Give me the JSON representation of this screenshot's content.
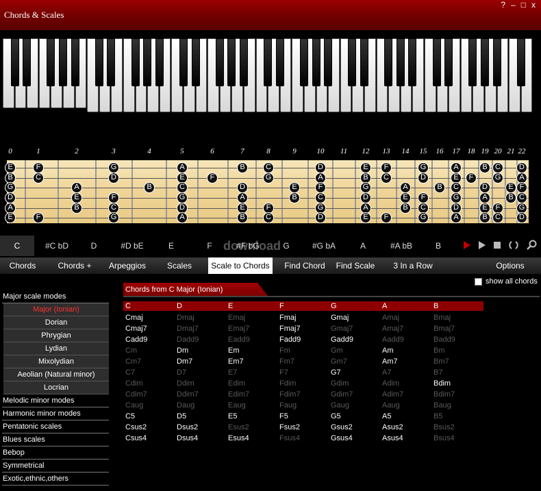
{
  "window": {
    "title": "Chords & Scales",
    "buttons": [
      "?",
      "–",
      "□",
      "x"
    ]
  },
  "fret_numbers": [
    "0",
    "1",
    "2",
    "3",
    "4",
    "5",
    "6",
    "7",
    "8",
    "9",
    "10",
    "11",
    "12",
    "13",
    "14",
    "15",
    "16",
    "17",
    "18",
    "19",
    "20",
    "21",
    "22"
  ],
  "fretboard_notes": [
    {
      "fret": 0,
      "string": 0,
      "label": "E"
    },
    {
      "fret": 0,
      "string": 1,
      "label": "B"
    },
    {
      "fret": 0,
      "string": 2,
      "label": "G"
    },
    {
      "fret": 0,
      "string": 3,
      "label": "D"
    },
    {
      "fret": 0,
      "string": 4,
      "label": "A"
    },
    {
      "fret": 0,
      "string": 5,
      "label": "E"
    },
    {
      "fret": 1,
      "string": 0,
      "label": "F"
    },
    {
      "fret": 1,
      "string": 1,
      "label": "C"
    },
    {
      "fret": 1,
      "string": 5,
      "label": "F"
    },
    {
      "fret": 2,
      "string": 2,
      "label": "A"
    },
    {
      "fret": 2,
      "string": 3,
      "label": "E"
    },
    {
      "fret": 2,
      "string": 4,
      "label": "B"
    },
    {
      "fret": 3,
      "string": 0,
      "label": "G"
    },
    {
      "fret": 3,
      "string": 1,
      "label": "D"
    },
    {
      "fret": 3,
      "string": 3,
      "label": "F"
    },
    {
      "fret": 3,
      "string": 4,
      "label": "C"
    },
    {
      "fret": 3,
      "string": 5,
      "label": "G"
    },
    {
      "fret": 4,
      "string": 2,
      "label": "B"
    },
    {
      "fret": 5,
      "string": 0,
      "label": "A"
    },
    {
      "fret": 5,
      "string": 1,
      "label": "E"
    },
    {
      "fret": 5,
      "string": 2,
      "label": "C"
    },
    {
      "fret": 5,
      "string": 3,
      "label": "G"
    },
    {
      "fret": 5,
      "string": 4,
      "label": "D"
    },
    {
      "fret": 5,
      "string": 5,
      "label": "A"
    },
    {
      "fret": 6,
      "string": 1,
      "label": "F"
    },
    {
      "fret": 7,
      "string": 0,
      "label": "B"
    },
    {
      "fret": 7,
      "string": 2,
      "label": "D"
    },
    {
      "fret": 7,
      "string": 3,
      "label": "A"
    },
    {
      "fret": 7,
      "string": 4,
      "label": "E"
    },
    {
      "fret": 7,
      "string": 5,
      "label": "B"
    },
    {
      "fret": 8,
      "string": 0,
      "label": "C"
    },
    {
      "fret": 8,
      "string": 1,
      "label": "G"
    },
    {
      "fret": 8,
      "string": 4,
      "label": "F"
    },
    {
      "fret": 8,
      "string": 5,
      "label": "C"
    },
    {
      "fret": 9,
      "string": 2,
      "label": "E"
    },
    {
      "fret": 9,
      "string": 3,
      "label": "B"
    },
    {
      "fret": 10,
      "string": 0,
      "label": "D"
    },
    {
      "fret": 10,
      "string": 1,
      "label": "A"
    },
    {
      "fret": 10,
      "string": 2,
      "label": "F"
    },
    {
      "fret": 10,
      "string": 3,
      "label": "C"
    },
    {
      "fret": 10,
      "string": 4,
      "label": "G"
    },
    {
      "fret": 10,
      "string": 5,
      "label": "D"
    },
    {
      "fret": 12,
      "string": 0,
      "label": "E"
    },
    {
      "fret": 12,
      "string": 1,
      "label": "B"
    },
    {
      "fret": 12,
      "string": 2,
      "label": "G"
    },
    {
      "fret": 12,
      "string": 3,
      "label": "D"
    },
    {
      "fret": 12,
      "string": 4,
      "label": "A"
    },
    {
      "fret": 12,
      "string": 5,
      "label": "E"
    },
    {
      "fret": 13,
      "string": 0,
      "label": "F"
    },
    {
      "fret": 13,
      "string": 1,
      "label": "C"
    },
    {
      "fret": 13,
      "string": 5,
      "label": "F"
    },
    {
      "fret": 14,
      "string": 2,
      "label": "A"
    },
    {
      "fret": 14,
      "string": 3,
      "label": "E"
    },
    {
      "fret": 14,
      "string": 4,
      "label": "B"
    },
    {
      "fret": 15,
      "string": 0,
      "label": "G"
    },
    {
      "fret": 15,
      "string": 1,
      "label": "D"
    },
    {
      "fret": 15,
      "string": 3,
      "label": "F"
    },
    {
      "fret": 15,
      "string": 4,
      "label": "C"
    },
    {
      "fret": 15,
      "string": 5,
      "label": "G"
    },
    {
      "fret": 16,
      "string": 2,
      "label": "B"
    },
    {
      "fret": 17,
      "string": 0,
      "label": "A"
    },
    {
      "fret": 17,
      "string": 1,
      "label": "E"
    },
    {
      "fret": 17,
      "string": 2,
      "label": "C"
    },
    {
      "fret": 17,
      "string": 3,
      "label": "G"
    },
    {
      "fret": 17,
      "string": 4,
      "label": "D"
    },
    {
      "fret": 17,
      "string": 5,
      "label": "A"
    },
    {
      "fret": 18,
      "string": 1,
      "label": "F"
    },
    {
      "fret": 19,
      "string": 0,
      "label": "B"
    },
    {
      "fret": 19,
      "string": 2,
      "label": "D"
    },
    {
      "fret": 19,
      "string": 3,
      "label": "A"
    },
    {
      "fret": 19,
      "string": 4,
      "label": "E"
    },
    {
      "fret": 19,
      "string": 5,
      "label": "B"
    },
    {
      "fret": 20,
      "string": 0,
      "label": "C"
    },
    {
      "fret": 20,
      "string": 1,
      "label": "G"
    },
    {
      "fret": 20,
      "string": 4,
      "label": "F"
    },
    {
      "fret": 20,
      "string": 5,
      "label": "C"
    },
    {
      "fret": 21,
      "string": 2,
      "label": "E"
    },
    {
      "fret": 21,
      "string": 3,
      "label": "B"
    },
    {
      "fret": 22,
      "string": 0,
      "label": "D"
    },
    {
      "fret": 22,
      "string": 1,
      "label": "A"
    },
    {
      "fret": 22,
      "string": 2,
      "label": "F"
    },
    {
      "fret": 22,
      "string": 3,
      "label": "C"
    },
    {
      "fret": 22,
      "string": 4,
      "label": "G"
    },
    {
      "fret": 22,
      "string": 5,
      "label": "D"
    }
  ],
  "notebar": {
    "notes": [
      "C",
      "#C bD",
      "D",
      "#D bE",
      "E",
      "F",
      "#F bG",
      "G",
      "#G bA",
      "A",
      "#A bB",
      "B"
    ],
    "selected": "C",
    "watermark": "download",
    "transport": [
      "record-icon",
      "play-icon",
      "stop-icon",
      "loop-icon",
      "zoom-icon"
    ]
  },
  "tabs": [
    "Chords",
    "Chords +",
    "Arpeggios",
    "Scales",
    "Scale to Chords",
    "Find Chord",
    "Find Scale",
    "3 In a Row",
    "Options"
  ],
  "active_tab": "Scale to Chords",
  "sidebar": {
    "group_head": "Major scale modes",
    "modes": [
      "Major (Ionian)",
      "Dorian",
      "Phrygian",
      "Lydian",
      "Mixolydian",
      "Aeolian (Natural minor)",
      "Locrian"
    ],
    "active_mode": "Major (Ionian)",
    "other_groups": [
      "Melodic minor modes",
      "Harmonic minor modes",
      "Pentatonic scales",
      "Blues scales",
      "Bebop",
      "Symmetrical",
      "Exotic,ethnic,others"
    ]
  },
  "main": {
    "heading": "Chords from C Major (Ionian)",
    "show_all_label": "show all chords",
    "columns": [
      "C",
      "D",
      "E",
      "F",
      "G",
      "A",
      "B"
    ],
    "rows": [
      [
        [
          "Cmaj",
          1
        ],
        [
          "Dmaj",
          0
        ],
        [
          "Emaj",
          0
        ],
        [
          "Fmaj",
          1
        ],
        [
          "Gmaj",
          1
        ],
        [
          "Amaj",
          0
        ],
        [
          "Bmaj",
          0
        ]
      ],
      [
        [
          "Cmaj7",
          1
        ],
        [
          "Dmaj7",
          0
        ],
        [
          "Emaj7",
          0
        ],
        [
          "Fmaj7",
          1
        ],
        [
          "Gmaj7",
          0
        ],
        [
          "Amaj7",
          0
        ],
        [
          "Bmaj7",
          0
        ]
      ],
      [
        [
          "Cadd9",
          1
        ],
        [
          "Dadd9",
          0
        ],
        [
          "Eadd9",
          0
        ],
        [
          "Fadd9",
          1
        ],
        [
          "Gadd9",
          1
        ],
        [
          "Aadd9",
          0
        ],
        [
          "Badd9",
          0
        ]
      ],
      [
        [
          "Cm",
          0
        ],
        [
          "Dm",
          1
        ],
        [
          "Em",
          1
        ],
        [
          "Fm",
          0
        ],
        [
          "Gm",
          0
        ],
        [
          "Am",
          1
        ],
        [
          "Bm",
          0
        ]
      ],
      [
        [
          "Cm7",
          0
        ],
        [
          "Dm7",
          1
        ],
        [
          "Em7",
          1
        ],
        [
          "Fm7",
          0
        ],
        [
          "Gm7",
          0
        ],
        [
          "Am7",
          1
        ],
        [
          "Bm7",
          0
        ]
      ],
      [
        [
          "C7",
          0
        ],
        [
          "D7",
          0
        ],
        [
          "E7",
          0
        ],
        [
          "F7",
          0
        ],
        [
          "G7",
          1
        ],
        [
          "A7",
          0
        ],
        [
          "B7",
          0
        ]
      ],
      [
        [
          "Cdim",
          0
        ],
        [
          "Ddim",
          0
        ],
        [
          "Edim",
          0
        ],
        [
          "Fdim",
          0
        ],
        [
          "Gdim",
          0
        ],
        [
          "Adim",
          0
        ],
        [
          "Bdim",
          1
        ]
      ],
      [
        [
          "Cdim7",
          0
        ],
        [
          "Ddim7",
          0
        ],
        [
          "Edim7",
          0
        ],
        [
          "Fdim7",
          0
        ],
        [
          "Gdim7",
          0
        ],
        [
          "Adim7",
          0
        ],
        [
          "Bdim7",
          0
        ]
      ],
      [
        [
          "Caug",
          0
        ],
        [
          "Daug",
          0
        ],
        [
          "Eaug",
          0
        ],
        [
          "Faug",
          0
        ],
        [
          "Gaug",
          0
        ],
        [
          "Aaug",
          0
        ],
        [
          "Baug",
          0
        ]
      ],
      [
        [
          "C5",
          1
        ],
        [
          "D5",
          1
        ],
        [
          "E5",
          1
        ],
        [
          "F5",
          1
        ],
        [
          "G5",
          1
        ],
        [
          "A5",
          1
        ],
        [
          "B5",
          0
        ]
      ],
      [
        [
          "Csus2",
          1
        ],
        [
          "Dsus2",
          1
        ],
        [
          "Esus2",
          0
        ],
        [
          "Fsus2",
          1
        ],
        [
          "Gsus2",
          1
        ],
        [
          "Asus2",
          1
        ],
        [
          "Bsus2",
          0
        ]
      ],
      [
        [
          "Csus4",
          1
        ],
        [
          "Dsus4",
          1
        ],
        [
          "Esus4",
          1
        ],
        [
          "Fsus4",
          0
        ],
        [
          "Gsus4",
          1
        ],
        [
          "Asus4",
          1
        ],
        [
          "Bsus4",
          0
        ]
      ]
    ]
  },
  "colors": {
    "accent": "#8e0000",
    "active_mode": "#ff3030",
    "dimmed": "#5a5a5a"
  }
}
